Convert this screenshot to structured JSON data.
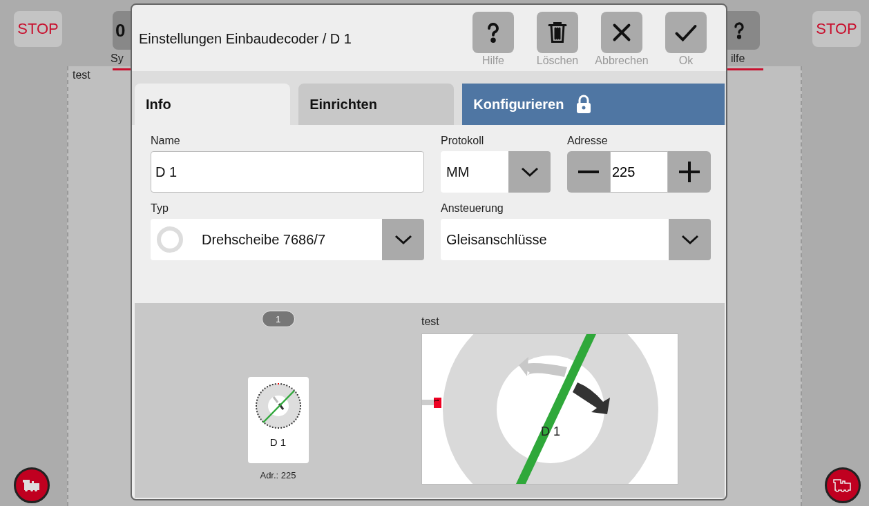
{
  "background": {
    "stop_left": "STOP",
    "toolbar_left": {
      "value": "0",
      "label": "Sy"
    },
    "panel_title": "test",
    "toolbar_right": {
      "label": "ilfe"
    },
    "stop_right": "STOP"
  },
  "dialog": {
    "title": "Einstellungen Einbaudecoder / D 1",
    "actions": [
      {
        "kind": "help",
        "label": "Hilfe"
      },
      {
        "kind": "delete",
        "label": "Löschen"
      },
      {
        "kind": "cancel",
        "label": "Abbrechen"
      },
      {
        "kind": "ok",
        "label": "Ok"
      }
    ],
    "tabs": [
      {
        "label": "Info",
        "selected": true,
        "locked": false
      },
      {
        "label": "Einrichten",
        "selected": false,
        "locked": false
      },
      {
        "label": "Konfigurieren",
        "selected": false,
        "locked": true
      }
    ],
    "form": {
      "name": {
        "label": "Name",
        "value": "D 1"
      },
      "protocol": {
        "label": "Protokoll",
        "value": "MM"
      },
      "address": {
        "label": "Adresse",
        "value": "225"
      },
      "type": {
        "label": "Typ",
        "value": "Drehscheibe 7686/7"
      },
      "control": {
        "label": "Ansteuerung",
        "value": "Gleisanschlüsse"
      }
    },
    "preview": {
      "page_badge": "1",
      "tile": {
        "name": "D 1",
        "address": "Adr.: 225"
      },
      "layout": {
        "title": "test",
        "item_label": "D 1",
        "port_label": "1"
      }
    }
  }
}
